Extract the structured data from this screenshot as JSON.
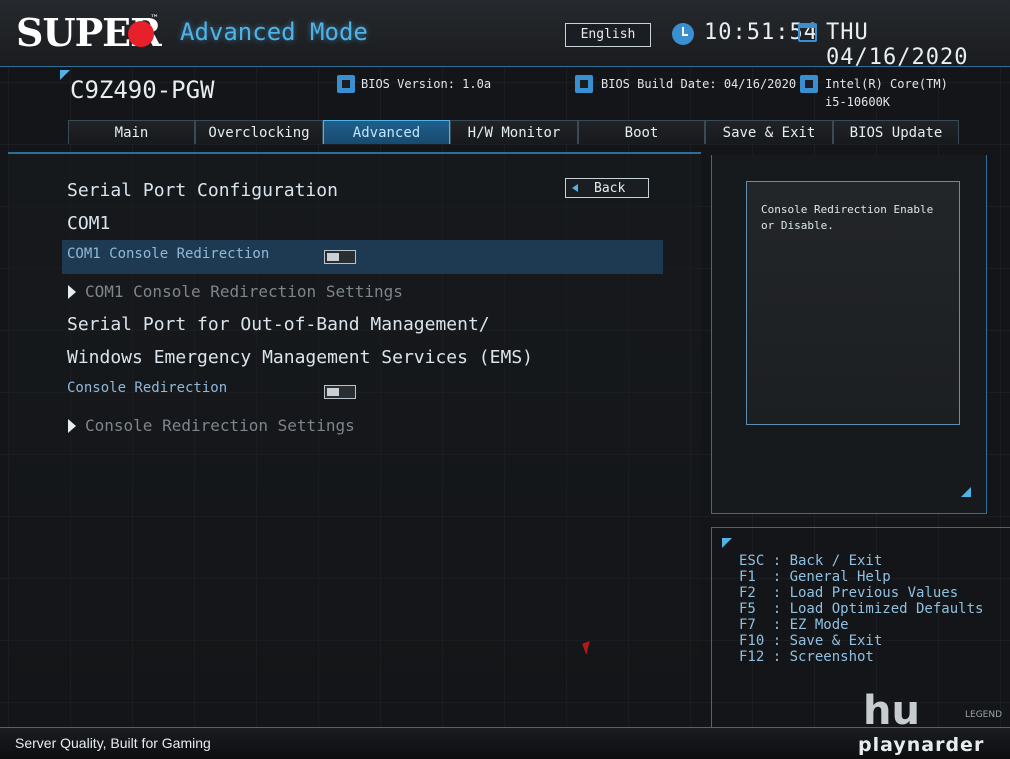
{
  "header": {
    "logo_text": "SUPER",
    "logo_tm": "™",
    "mode_title": "Advanced Mode",
    "language": "English",
    "time": "10:51:54",
    "date": "THU 04/16/2020"
  },
  "info": {
    "model": "C9Z490-PGW",
    "bios_version": "BIOS Version: 1.0a",
    "bios_build_date": "BIOS Build Date: 04/16/2020",
    "cpu_line1": "Intel(R) Core(TM)",
    "cpu_line2": "i5-10600K"
  },
  "tabs": [
    "Main",
    "Overclocking",
    "Advanced",
    "H/W Monitor",
    "Boot",
    "Save & Exit",
    "BIOS Update"
  ],
  "active_tab": "Advanced",
  "main": {
    "back_label": "Back",
    "title": "Serial Port Configuration",
    "com1_heading": "COM1",
    "com1_redirection_label": "COM1 Console Redirection",
    "com1_redirection_settings": "COM1 Console Redirection Settings",
    "oob_heading_line1": "Serial Port for Out-of-Band Management/",
    "oob_heading_line2": "Windows Emergency Management Services (EMS)",
    "console_redirection_label": "Console Redirection",
    "console_redirection_settings": "Console Redirection Settings",
    "toggles": {
      "com1_console_redirection": false,
      "console_redirection": false
    }
  },
  "help": {
    "text": "Console Redirection Enable or Disable."
  },
  "keys": [
    "ESC : Back / Exit",
    "F1  : General Help",
    "F2  : Load Previous Values",
    "F5  : Load Optimized Defaults",
    "F7  : EZ Mode",
    "F10 : Save & Exit",
    "F12 : Screenshot"
  ],
  "footer": {
    "slogan": "Server Quality, Built for Gaming",
    "watermark": "playnarder",
    "watermark_sub": "LEGEND",
    "watermark_mark": "hu"
  },
  "colors": {
    "accent": "#4fb3e8",
    "brand_red": "#e8202a",
    "active_tab": "#1f5f8c",
    "selected_row": "#1d3a52"
  }
}
